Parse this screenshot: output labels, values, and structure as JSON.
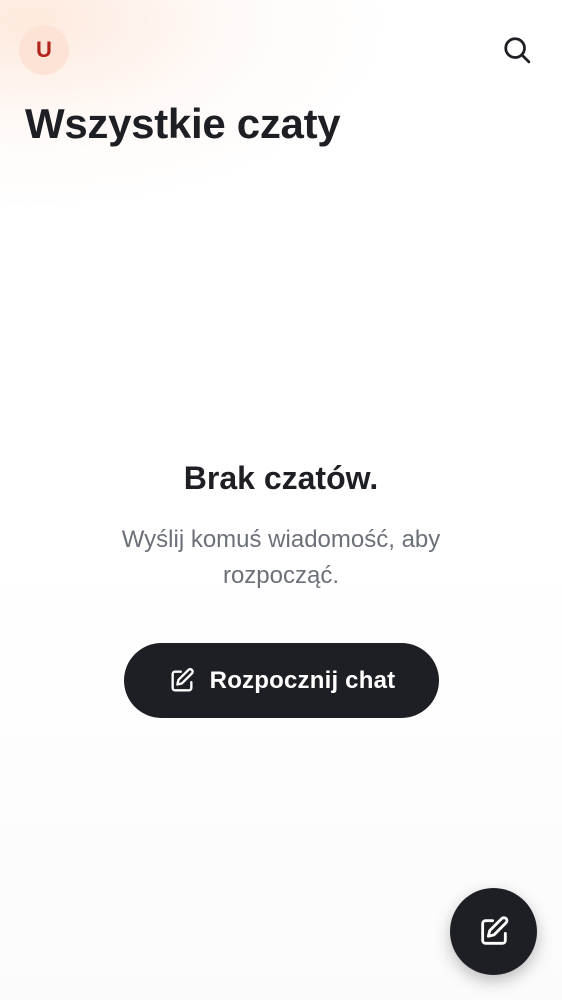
{
  "header": {
    "avatar_initial": "U",
    "title": "Wszystkie czaty",
    "search_icon": "search-icon"
  },
  "empty_state": {
    "title": "Brak czatów.",
    "description": "Wyślij komuś wiadomość, aby rozpocząć.",
    "button_label": "Rozpocznij chat",
    "button_icon": "edit-icon"
  },
  "fab": {
    "icon": "edit-icon"
  },
  "colors": {
    "primary": "#1e1f24",
    "avatar_bg": "#fde3d6",
    "avatar_text": "#b3261e",
    "muted_text": "#6c7079"
  }
}
